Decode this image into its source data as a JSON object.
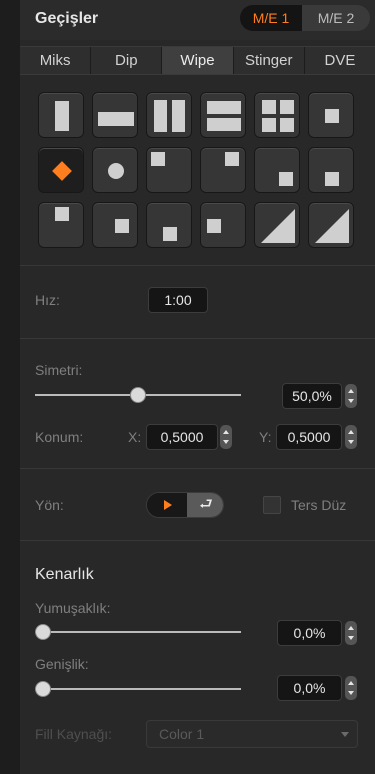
{
  "header": {
    "title": "Geçişler",
    "me1": "M/E 1",
    "me2": "M/E 2"
  },
  "tabs": [
    {
      "label": "Miks",
      "active": false
    },
    {
      "label": "Dip",
      "active": false
    },
    {
      "label": "Wipe",
      "active": true
    },
    {
      "label": "Stinger",
      "active": false
    },
    {
      "label": "DVE",
      "active": false
    }
  ],
  "wipe_patterns": {
    "selected": "diamond",
    "items": [
      "vertical-bar",
      "horizontal-bar",
      "vertical-split",
      "horizontal-split",
      "four-box",
      "center-box",
      "diamond",
      "circle",
      "top-left-box",
      "top-right-box",
      "bottom-right-box",
      "bottom-right-box-small",
      "left-box",
      "bottom-left-box",
      "bottom-center-box",
      "right-center-box",
      "diagonal-left",
      "diagonal-right"
    ]
  },
  "rate": {
    "label": "Hız:",
    "value": "1:00"
  },
  "symmetry": {
    "label": "Simetri:",
    "value": "50,0%",
    "level_percent": 50
  },
  "position": {
    "label": "Konum:",
    "x_label": "X:",
    "x_value": "0,5000",
    "y_label": "Y:",
    "y_value": "0,5000"
  },
  "direction": {
    "label": "Yön:",
    "reverse_label": "Ters Düz",
    "reverse_checked": false,
    "flip_glyph": "⮐"
  },
  "border": {
    "heading": "Kenarlık",
    "softness": {
      "label": "Yumuşaklık:",
      "value": "0,0%",
      "level_percent": 0
    },
    "width": {
      "label": "Genişlik:",
      "value": "0,0%",
      "level_percent": 0
    },
    "fill_source": {
      "label": "Fill Kaynağı:",
      "value": "Color 1"
    }
  },
  "colors": {
    "accent": "#ff7f1f",
    "panel": "#282828",
    "field": "#151515"
  }
}
